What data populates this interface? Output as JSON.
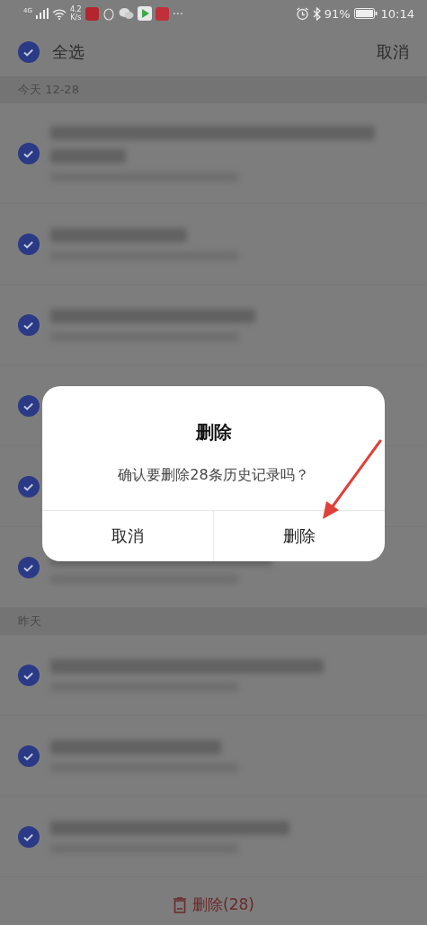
{
  "status_bar": {
    "network": "4G",
    "speed": "4.2",
    "speed_unit": "K/s",
    "more": "···",
    "battery_percent": "91%",
    "time": "10:14"
  },
  "top_bar": {
    "select_all": {
      "label": "全选",
      "checked": true
    },
    "cancel": "取消"
  },
  "sections": [
    {
      "header": "今天 12-28",
      "rows": [
        {
          "kind": "two-line",
          "checked": true
        },
        {
          "kind": "one-line",
          "checked": true
        },
        {
          "kind": "one-line",
          "checked": true
        },
        {
          "kind": "covered",
          "checked": true
        },
        {
          "kind": "covered",
          "checked": true
        },
        {
          "kind": "one-line",
          "checked": true
        }
      ]
    },
    {
      "header": "昨天",
      "rows": [
        {
          "kind": "one-line",
          "checked": true
        },
        {
          "kind": "one-line",
          "checked": true
        },
        {
          "kind": "one-line",
          "checked": true
        }
      ]
    }
  ],
  "bottom_bar": {
    "delete_label": "删除(28)"
  },
  "dialog": {
    "title": "删除",
    "message": "确认要删除28条历史记录吗？",
    "buttons": [
      {
        "label": "取消"
      },
      {
        "label": "删除"
      }
    ],
    "annotation": {
      "kind": "arrow"
    }
  }
}
